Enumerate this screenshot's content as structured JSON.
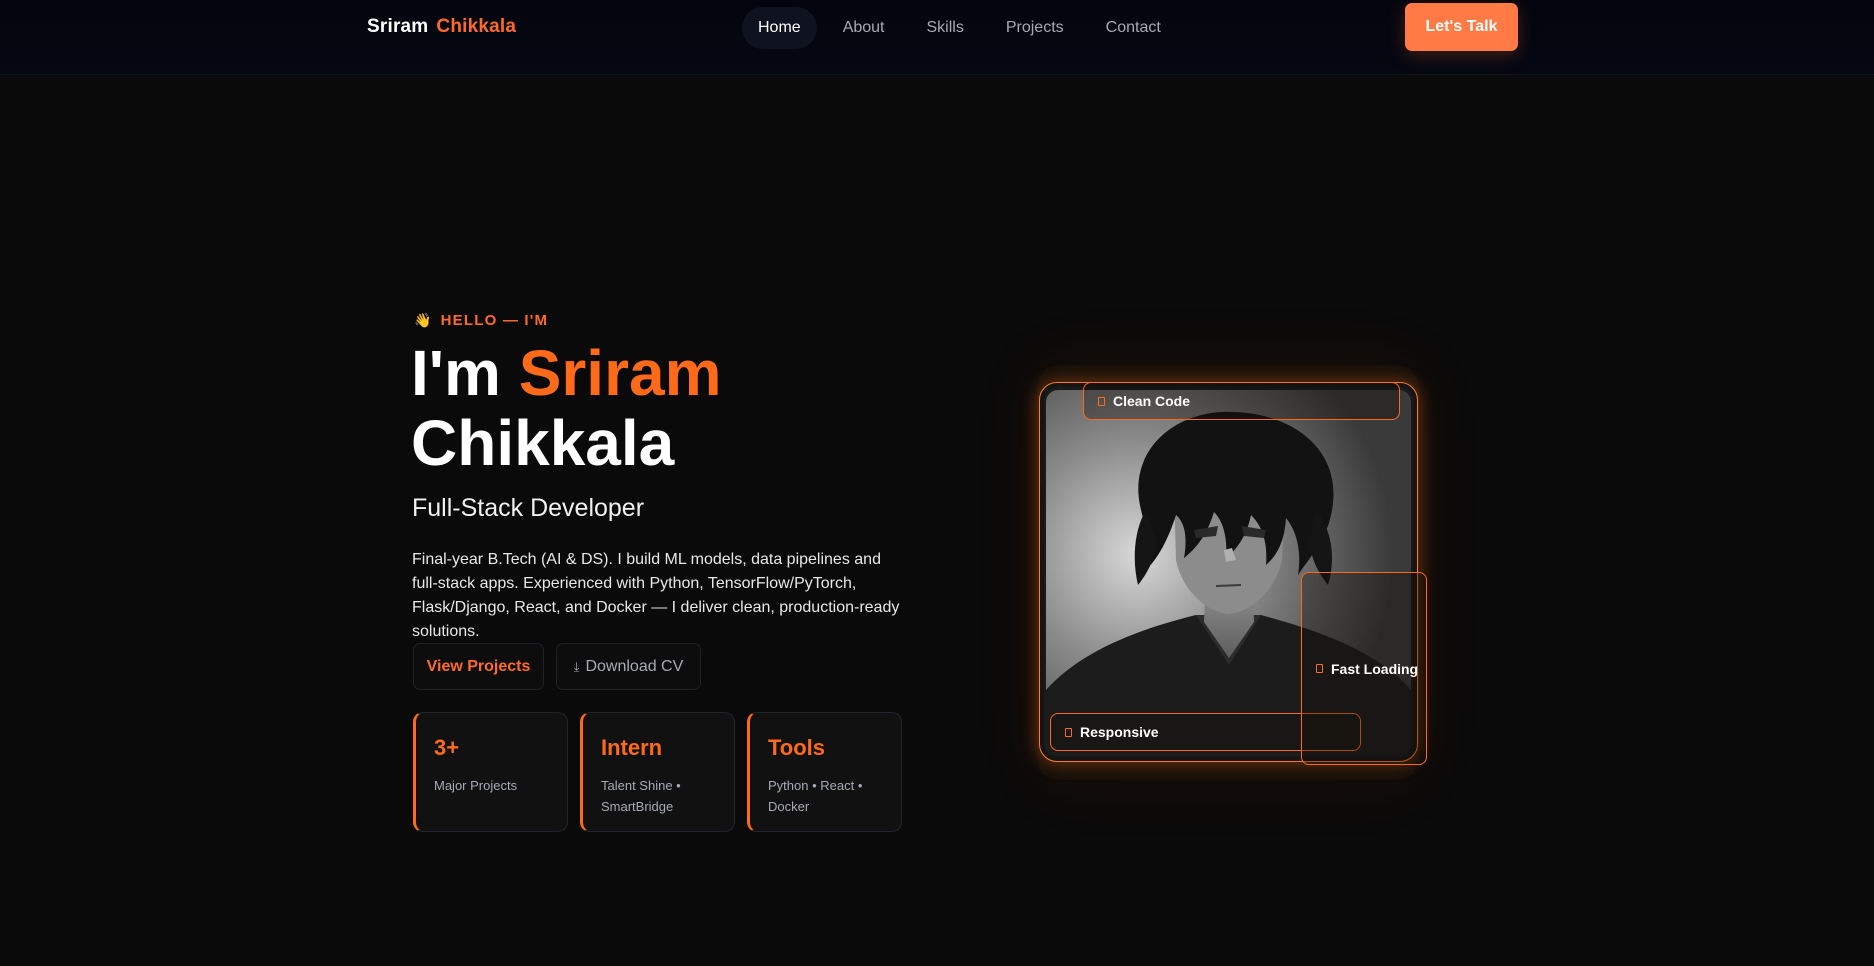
{
  "nav": {
    "brand_first": "Sriram",
    "brand_last": "Chikkala",
    "links": [
      {
        "label": "Home",
        "active": true
      },
      {
        "label": "About",
        "active": false
      },
      {
        "label": "Skills",
        "active": false
      },
      {
        "label": "Projects",
        "active": false
      },
      {
        "label": "Contact",
        "active": false
      }
    ],
    "cta_label": "Let's Talk"
  },
  "hero": {
    "eyebrow_icon": "waving-hand-icon",
    "eyebrow": "HELLO — I'M",
    "title_prefix": "I'm",
    "title_accent": "Sriram",
    "title_last": "Chikkala",
    "role": "Full-Stack Developer",
    "bio": "Final-year B.Tech (AI & DS). I build ML models, data pipelines and full-stack apps. Experienced with Python, TensorFlow/PyTorch, Flask/Django, React, and Docker — I deliver clean, production-ready solutions.",
    "primary_button": "View Projects",
    "secondary_button": "Download CV",
    "secondary_button_icon": "download-icon",
    "stats": [
      {
        "value": "3+",
        "label": "Major Projects"
      },
      {
        "value": "Intern",
        "label": "Talent Shine • SmartBridge"
      },
      {
        "value": "Tools",
        "label": "Python • React • Docker"
      }
    ]
  },
  "portrait_card": {
    "badges": [
      {
        "label": "Clean Code",
        "icon": "code-icon"
      },
      {
        "label": "Responsive",
        "icon": "mobile-icon"
      },
      {
        "label": "Fast Loading",
        "icon": "bolt-icon"
      }
    ]
  },
  "colors": {
    "accent": "#ff6a1a",
    "cta_bg": "#ff7a45",
    "page_bg": "#0a0a0a",
    "nav_bg": "#03050e",
    "muted_text": "#a7aab5"
  }
}
